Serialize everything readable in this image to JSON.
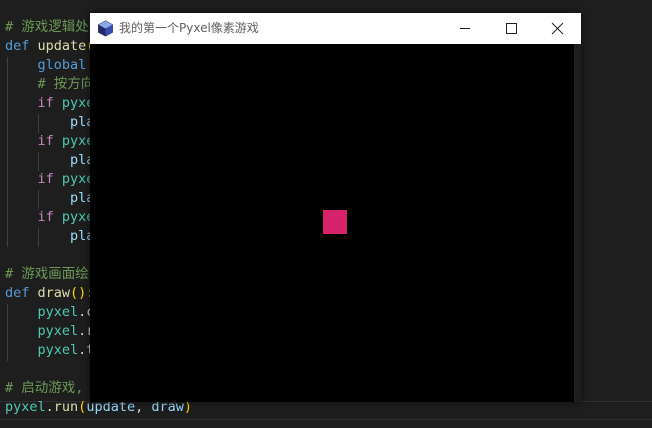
{
  "editor": {
    "lines": [
      {
        "top": 0,
        "segments": []
      },
      {
        "segments": [
          {
            "t": "# 游戏逻辑处",
            "c": "comment"
          }
        ]
      },
      {
        "segments": [
          {
            "t": "def ",
            "c": "kw"
          },
          {
            "t": "update",
            "c": "func"
          },
          {
            "t": "(",
            "c": "paren"
          }
        ]
      },
      {
        "segments": [
          {
            "t": "    ",
            "c": "plain"
          },
          {
            "t": "global",
            "c": "kw"
          }
        ]
      },
      {
        "segments": [
          {
            "t": "    ",
            "c": "plain"
          },
          {
            "t": "# 按方向",
            "c": "comment"
          }
        ]
      },
      {
        "segments": [
          {
            "t": "    ",
            "c": "plain"
          },
          {
            "t": "if ",
            "c": "ctrl"
          },
          {
            "t": "pyxe",
            "c": "cls"
          }
        ]
      },
      {
        "segments": [
          {
            "t": "        ",
            "c": "plain"
          },
          {
            "t": "pla",
            "c": "var"
          }
        ]
      },
      {
        "segments": [
          {
            "t": "    ",
            "c": "plain"
          },
          {
            "t": "if ",
            "c": "ctrl"
          },
          {
            "t": "pyxe",
            "c": "cls"
          }
        ]
      },
      {
        "segments": [
          {
            "t": "        ",
            "c": "plain"
          },
          {
            "t": "pla",
            "c": "var"
          }
        ]
      },
      {
        "segments": [
          {
            "t": "    ",
            "c": "plain"
          },
          {
            "t": "if ",
            "c": "ctrl"
          },
          {
            "t": "pyxe",
            "c": "cls"
          }
        ]
      },
      {
        "segments": [
          {
            "t": "        ",
            "c": "plain"
          },
          {
            "t": "pla",
            "c": "var"
          }
        ]
      },
      {
        "segments": [
          {
            "t": "    ",
            "c": "plain"
          },
          {
            "t": "if ",
            "c": "ctrl"
          },
          {
            "t": "pyxe",
            "c": "cls"
          }
        ]
      },
      {
        "segments": [
          {
            "t": "        ",
            "c": "plain"
          },
          {
            "t": "pla",
            "c": "var"
          }
        ]
      },
      {
        "segments": []
      },
      {
        "segments": [
          {
            "t": "# 游戏画面绘",
            "c": "comment"
          }
        ]
      },
      {
        "segments": [
          {
            "t": "def ",
            "c": "kw"
          },
          {
            "t": "draw",
            "c": "func"
          },
          {
            "t": "():",
            "c": "paren"
          }
        ]
      },
      {
        "segments": [
          {
            "t": "    ",
            "c": "plain"
          },
          {
            "t": "pyxel",
            "c": "cls"
          },
          {
            "t": ".c",
            "c": "plain"
          }
        ]
      },
      {
        "segments": [
          {
            "t": "    ",
            "c": "plain"
          },
          {
            "t": "pyxel",
            "c": "cls"
          },
          {
            "t": ".r",
            "c": "plain"
          }
        ]
      },
      {
        "segments": [
          {
            "t": "    ",
            "c": "plain"
          },
          {
            "t": "pyxel",
            "c": "cls"
          },
          {
            "t": ".t",
            "c": "plain"
          }
        ]
      },
      {
        "segments": []
      },
      {
        "segments": [
          {
            "t": "# 启动游戏,",
            "c": "comment"
          }
        ]
      },
      {
        "segments": [
          {
            "t": "pyxel",
            "c": "cls"
          },
          {
            "t": ".",
            "c": "plain"
          },
          {
            "t": "run",
            "c": "func"
          },
          {
            "t": "(",
            "c": "paren"
          },
          {
            "t": "update",
            "c": "var"
          },
          {
            "t": ", ",
            "c": "plain"
          },
          {
            "t": "draw",
            "c": "var"
          },
          {
            "t": ")",
            "c": "paren"
          }
        ]
      }
    ]
  },
  "window": {
    "title": "我的第一个Pyxel像素游戏",
    "icons": {
      "app": "pyxel-cube-icon",
      "minimize": "minimize-icon",
      "maximize": "maximize-icon",
      "close": "close-icon"
    },
    "player_color": "#d6226a"
  },
  "colors": {
    "editor_bg": "#1e1e1e",
    "canvas_bg": "#000000",
    "titlebar_bg": "#ffffff"
  }
}
